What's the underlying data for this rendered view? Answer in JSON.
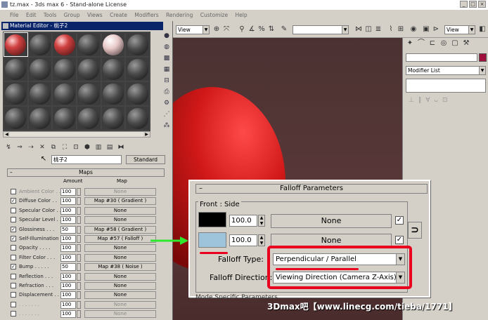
{
  "window": {
    "title": "tz.max - 3ds max 6 - Stand-alone License"
  },
  "menu": [
    "File",
    "Edit",
    "Tools",
    "Group",
    "Views",
    "Create",
    "Modifiers",
    "Rendering",
    "Customize",
    "Help"
  ],
  "toolbar": {
    "view_left": "View",
    "view_right": "View"
  },
  "command_panel": {
    "modifier_list": "Modifier List"
  },
  "material_editor": {
    "title": "Material Editor - 桃子2",
    "material_name": "桃子2",
    "material_type": "Standard",
    "maps": {
      "header": "Maps",
      "col_amount": "Amount",
      "col_map": "Map",
      "rows": [
        {
          "label": "Ambient Color . .",
          "amount": "100",
          "map": "None",
          "checked": false,
          "dim": true
        },
        {
          "label": "Diffuse Color . .",
          "amount": "100",
          "map": "Map #30 ( Gradient )",
          "checked": true,
          "dim": false
        },
        {
          "label": "Specular Color . .",
          "amount": "100",
          "map": "None",
          "checked": false,
          "dim": false
        },
        {
          "label": "Specular Level . .",
          "amount": "100",
          "map": "None",
          "checked": false,
          "dim": false
        },
        {
          "label": "Glossiness . . .",
          "amount": "50",
          "map": "Map #58 ( Gradient )",
          "checked": true,
          "dim": false
        },
        {
          "label": "Self-Illumination .",
          "amount": "100",
          "map": "Map #57 ( Falloff )",
          "checked": true,
          "dim": false
        },
        {
          "label": "Opacity . . . .",
          "amount": "100",
          "map": "None",
          "checked": false,
          "dim": false
        },
        {
          "label": "Filter Color . . .",
          "amount": "100",
          "map": "None",
          "checked": false,
          "dim": false
        },
        {
          "label": "Bump . . . . .",
          "amount": "50",
          "map": "Map #38 ( Noise )",
          "checked": true,
          "dim": false
        },
        {
          "label": "Reflection . . .",
          "amount": "100",
          "map": "None",
          "checked": false,
          "dim": false
        },
        {
          "label": "Refraction . . .",
          "amount": "100",
          "map": "None",
          "checked": false,
          "dim": false
        },
        {
          "label": "Displacement . .",
          "amount": "100",
          "map": "None",
          "checked": false,
          "dim": false
        },
        {
          "label": ". . . . . . .",
          "amount": "100",
          "map": "None",
          "checked": false,
          "dim": true
        },
        {
          "label": ". . . . . . .",
          "amount": "100",
          "map": "None",
          "checked": false,
          "dim": true
        }
      ]
    }
  },
  "falloff": {
    "header": "Falloff Parameters",
    "group_label": "Front : Side",
    "front": {
      "value": "100.0",
      "map": "None",
      "color": "#000000"
    },
    "side": {
      "value": "100.0",
      "map": "None",
      "color": "#9ec4dc"
    },
    "falloff_type_label": "Falloff Type:",
    "falloff_type": "Perpendicular / Parallel",
    "falloff_direction_label": "Falloff Direction:",
    "falloff_direction": "Viewing Direction (Camera Z-Axis)",
    "mode_specific": "Mode Specific Parameters"
  },
  "watermark": "3Dmax吧【www.linecg.com/tieba/1771】",
  "colors": {
    "highlight": "#e8001e",
    "arrow": "#2ee82e",
    "titlebar": "#0a246a"
  }
}
